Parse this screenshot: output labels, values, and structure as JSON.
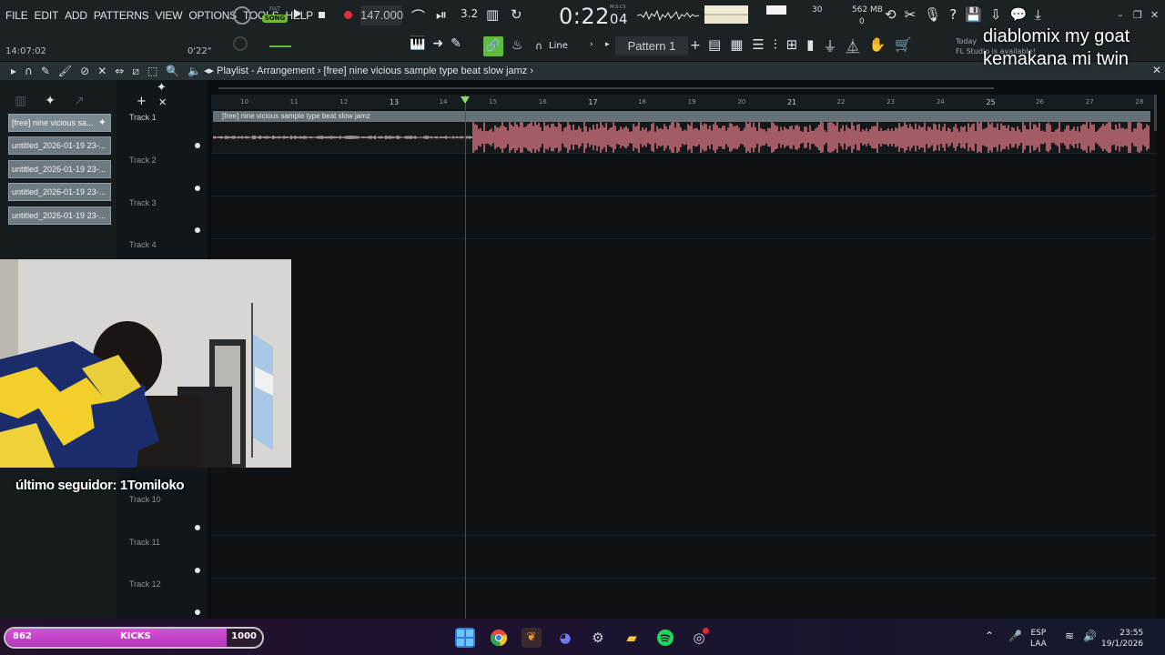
{
  "menu": [
    "FILE",
    "EDIT",
    "ADD",
    "PATTERNS",
    "VIEW",
    "OPTIONS",
    "TOOLS",
    "HELP"
  ],
  "transport": {
    "pat_label": "PAT",
    "song_label": "SONG",
    "tempo": "147.000",
    "time_main": "0:22",
    "time_sub": "04",
    "time_unit": "M:S:CS",
    "cpu": "30",
    "memory": "562 MB",
    "polyphony": "0"
  },
  "hints": {
    "time_of_day": "14:07:02",
    "position": "0'22\""
  },
  "toolbar2": {
    "snap_label": "Line",
    "pattern": "Pattern 1"
  },
  "news": {
    "line1": "Today",
    "line2": "FL Studio is available!"
  },
  "overlay": {
    "line1": "diablomix my goat",
    "line2": "kemakana mi twin"
  },
  "playlist": {
    "title_prefix": "Playlist - Arrangement",
    "title_item": "[free] nine vicious sample type beat slow jamz"
  },
  "picker": {
    "clips": [
      "[free] nine vicious sa...",
      "untitled_2026-01-19 23-...",
      "untitled_2026-01-19 23-...",
      "untitled_2026-01-19 23-...",
      "untitled_2026-01-19 23-..."
    ]
  },
  "tracks": [
    "Track 1",
    "Track 2",
    "Track 3",
    "Track 4",
    "Track 10",
    "Track 11",
    "Track 12"
  ],
  "ruler": [
    "10",
    "11",
    "12",
    "13",
    "14",
    "15",
    "16",
    "17",
    "18",
    "19",
    "20",
    "21",
    "22",
    "23",
    "24",
    "25",
    "26",
    "27",
    "28"
  ],
  "audio_clip": {
    "name": "[free] nine vicious sample type beat slow jamz"
  },
  "stream": {
    "follower": "último seguidor: 1Tomiloko"
  },
  "goal": {
    "current": "862",
    "label": "KICKS",
    "target": "1000",
    "progress": 0.862
  },
  "system": {
    "lang1": "ESP",
    "lang2": "LAA",
    "time": "23:55",
    "date": "19/1/2026"
  },
  "colors": {
    "accent_green": "#5fbd3a",
    "wave_pink": "#e07a86",
    "goal_pink": "#c544c8"
  }
}
